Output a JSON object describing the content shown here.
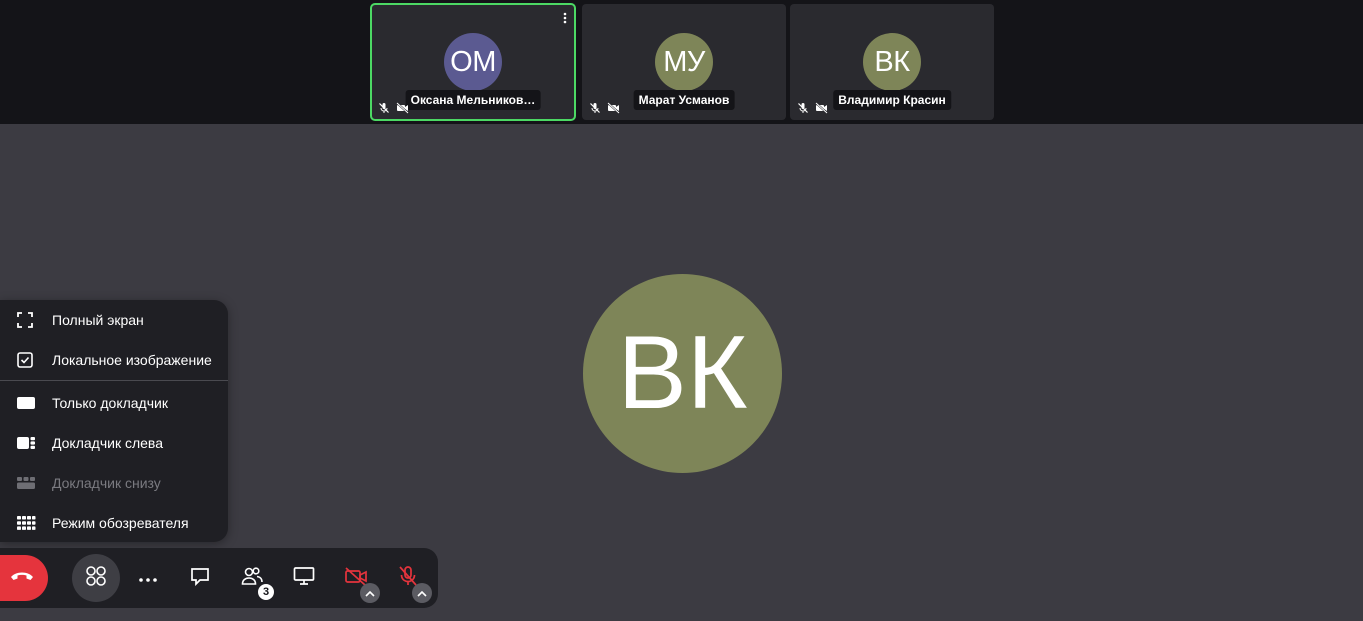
{
  "participants": [
    {
      "initials": "ОМ",
      "name": "Оксана Мельников…",
      "avatar_color": "#5b5a91",
      "active": true
    },
    {
      "initials": "МУ",
      "name": "Марат Усманов",
      "avatar_color": "#7e8558",
      "active": false
    },
    {
      "initials": "ВК",
      "name": "Владимир Красин",
      "avatar_color": "#7e8558",
      "active": false
    }
  ],
  "dominant": {
    "initials": "ВК",
    "avatar_color": "#7e8558"
  },
  "view_menu": {
    "items": [
      {
        "label": "Полный экран",
        "icon": "fullscreen-icon"
      },
      {
        "label": "Локальное изображение",
        "icon": "checkbox-checked-icon"
      },
      {
        "label": "Только докладчик",
        "icon": "speaker-only-icon"
      },
      {
        "label": "Докладчик слева",
        "icon": "speaker-left-icon"
      },
      {
        "label": "Докладчик снизу",
        "icon": "speaker-bottom-icon",
        "disabled": true
      },
      {
        "label": "Режим обозревателя",
        "icon": "grid-view-icon"
      }
    ]
  },
  "toolbar": {
    "participants_count": "3",
    "hangup_color": "#e5343d",
    "muted_color": "#e5343d"
  }
}
